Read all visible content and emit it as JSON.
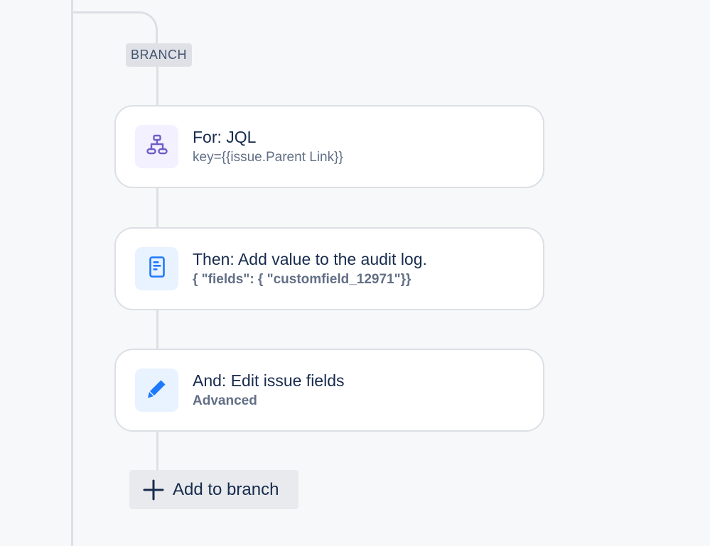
{
  "branch": {
    "label": "BRANCH"
  },
  "steps": [
    {
      "title": "For: JQL",
      "subtitle": "key={{issue.Parent Link}}",
      "icon": "hierarchy-icon",
      "icon_color": "#6e5dc6",
      "icon_bg": "#f3f0ff"
    },
    {
      "title": "Then: Add value to the audit log.",
      "subtitle": "{ \"fields\": { \"customfield_12971\"}}",
      "icon": "document-icon",
      "icon_color": "#1d7afc",
      "icon_bg": "#e9f2ff"
    },
    {
      "title": "And: Edit issue fields",
      "subtitle": "Advanced",
      "icon": "pencil-icon",
      "icon_color": "#1d7afc",
      "icon_bg": "#e9f2ff"
    }
  ],
  "add_button": {
    "label": "Add to branch",
    "icon": "plus-icon"
  },
  "colors": {
    "background": "#f7f8f9",
    "connector": "#dcdfe4",
    "text_primary": "#172b4d",
    "text_secondary": "#626f86"
  }
}
